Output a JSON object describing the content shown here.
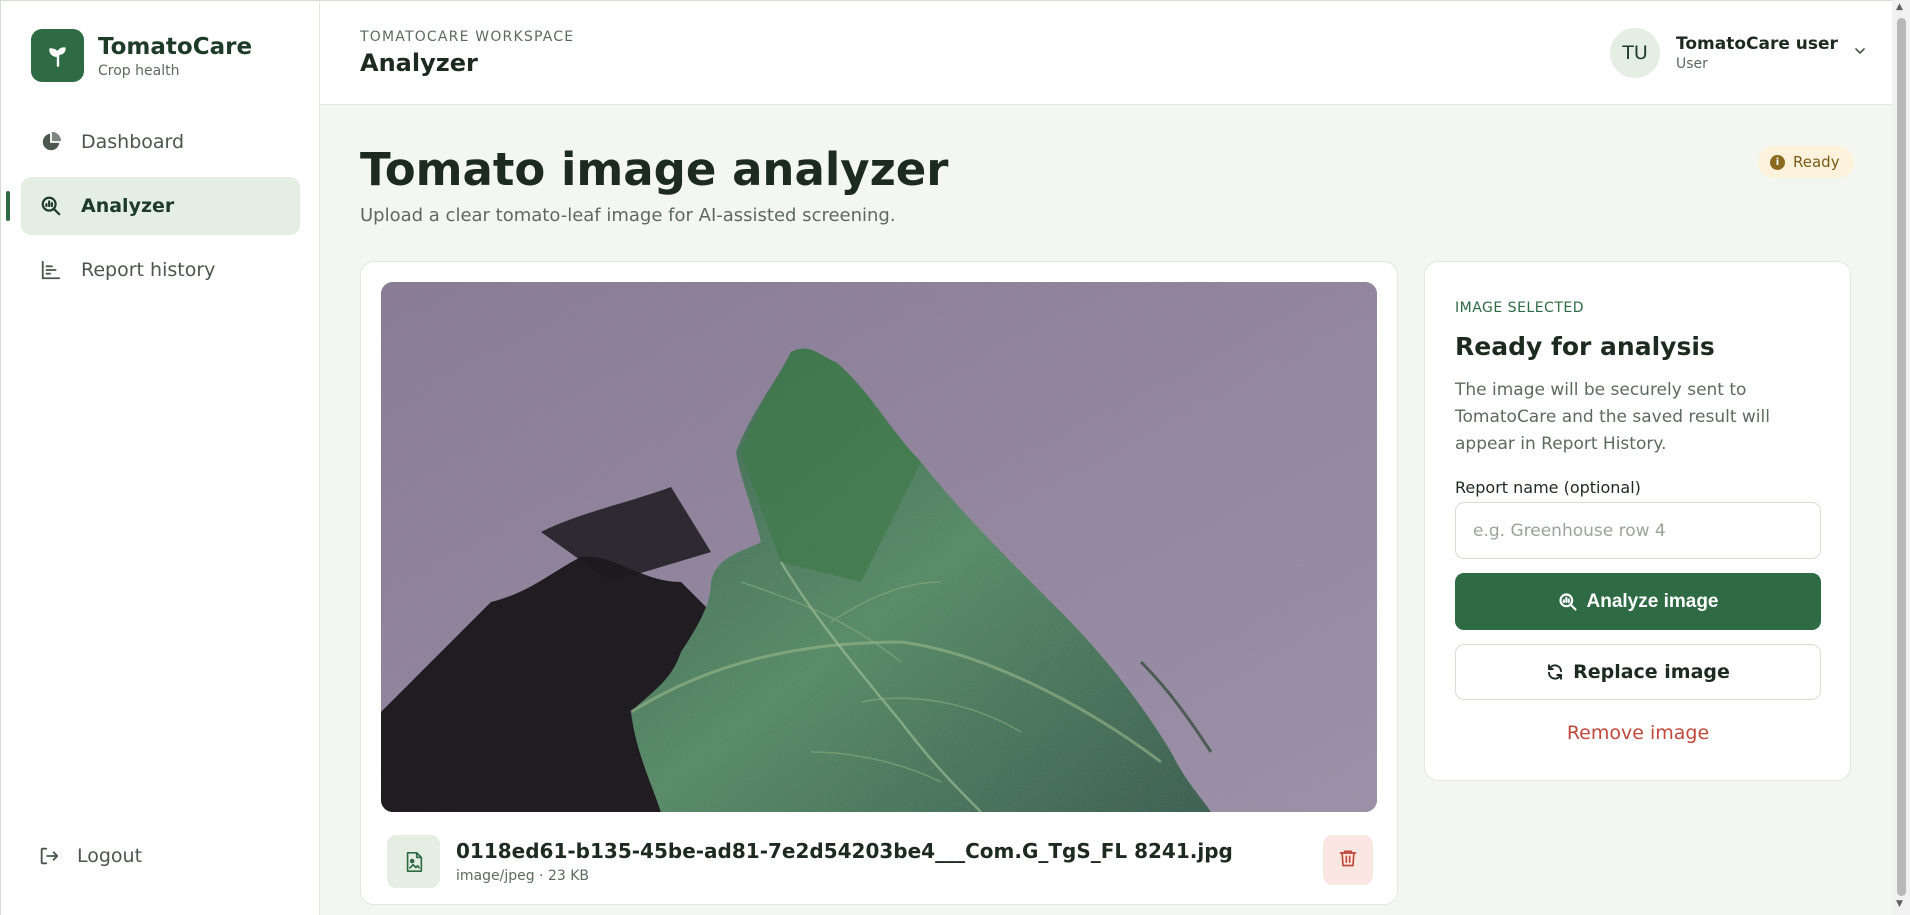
{
  "brand": {
    "name": "TomatoCare",
    "subtitle": "Crop health"
  },
  "sidebar": {
    "items": [
      {
        "label": "Dashboard",
        "icon": "pie-chart-icon",
        "active": false
      },
      {
        "label": "Analyzer",
        "icon": "scan-search-icon",
        "active": true
      },
      {
        "label": "Report history",
        "icon": "bar-chart-icon",
        "active": false
      }
    ],
    "logout_label": "Logout"
  },
  "header": {
    "workspace_label": "TOMATOCARE WORKSPACE",
    "title": "Analyzer",
    "user": {
      "initials": "TU",
      "name": "TomatoCare user",
      "role": "User"
    }
  },
  "main": {
    "title": "Tomato image analyzer",
    "subtitle": "Upload a clear tomato-leaf image for AI-assisted screening.",
    "status_badge": "Ready"
  },
  "preview": {
    "file_name": "0118ed61-b135-45be-ad81-7e2d54203be4___Com.G_TgS_FL 8241.jpg",
    "file_meta": "image/jpeg · 23 KB"
  },
  "analysis_panel": {
    "eyebrow": "IMAGE SELECTED",
    "title": "Ready for analysis",
    "description": "The image will be securely sent to TomatoCare and the saved result will appear in Report History.",
    "report_name_label": "Report name (optional)",
    "report_name_placeholder": "e.g. Greenhouse row 4",
    "report_name_value": "",
    "analyze_label": "Analyze image",
    "replace_label": "Replace image",
    "remove_label": "Remove image"
  },
  "colors": {
    "brand_green": "#2e6a43",
    "active_nav_bg": "#e4eee2",
    "badge_bg": "#fdf3dd",
    "danger": "#c2483c"
  }
}
